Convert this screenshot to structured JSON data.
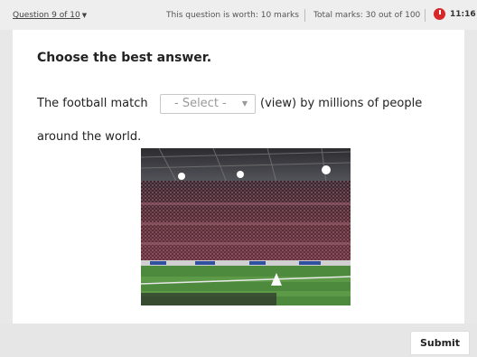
{
  "header": {
    "question_selector": "Question 9 of 10",
    "worth": "This question is worth: 10 marks",
    "total": "Total marks: 30 out of 100",
    "timer": "11:16"
  },
  "question": {
    "instruction": "Choose the best answer.",
    "text_before": "The football match",
    "select_placeholder": "- Select -",
    "text_after": "(view) by millions of people",
    "text_line2": "around the world."
  },
  "image": {
    "alt": "football stadium crowd"
  },
  "footer": {
    "submit_label": "Submit"
  }
}
